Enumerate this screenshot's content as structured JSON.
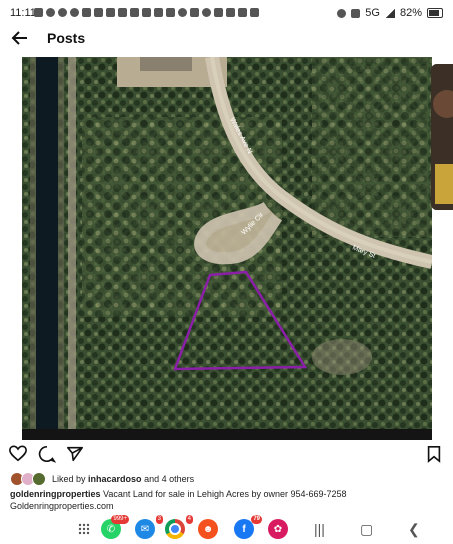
{
  "status_bar": {
    "time": "11:11",
    "network": "5G",
    "battery": "82%"
  },
  "header": {
    "title": "Posts"
  },
  "post": {
    "aerial_labels": [
      "Wales Ave N",
      "Wylie Cir",
      "Mary St"
    ],
    "likes": {
      "prefix": "Liked by",
      "user": "inhacardoso",
      "suffix": "and 4 others"
    },
    "caption": {
      "username": "goldenringproperties",
      "text": "Vacant Land for sale in Lehigh Acres by owner 954-669-7258",
      "link": "Goldenringproperties.com"
    }
  },
  "dock": {
    "whatsapp_badge": "999+",
    "messages_badge": "3",
    "chrome_badge": "4",
    "facebook_badge": "79"
  },
  "colors": {
    "parcel_outline": "#8b1fa8",
    "canal": "#0d1a22",
    "road": "#cfc4b0",
    "forest": "#354a2e"
  }
}
